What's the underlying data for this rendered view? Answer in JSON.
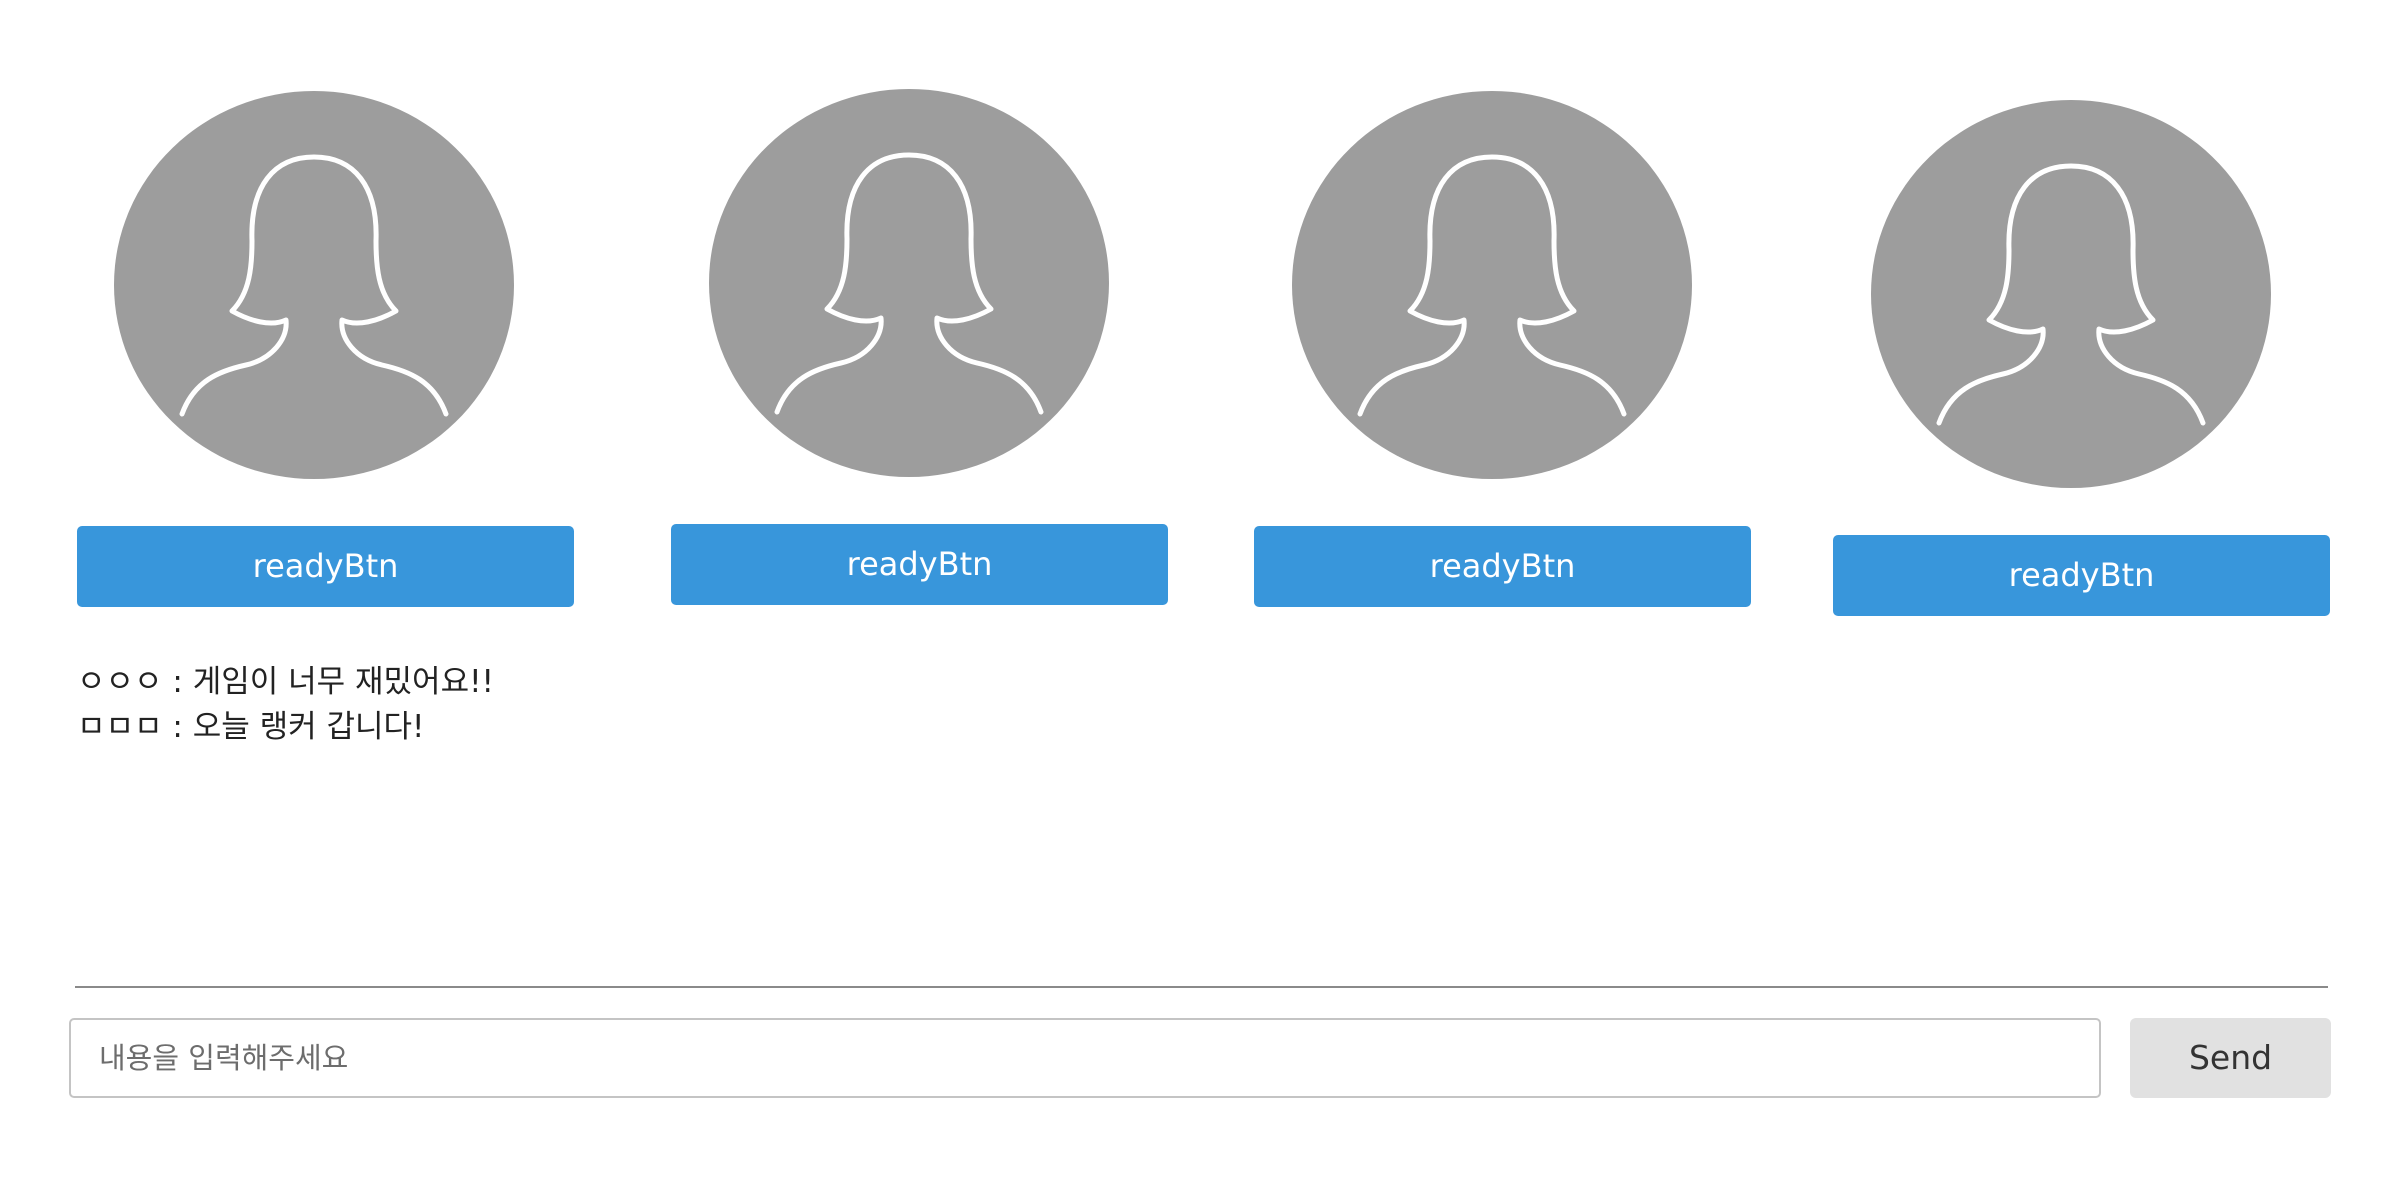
{
  "players": [
    {
      "ready_label": "readyBtn",
      "avatar_icon": "female-user-silhouette-icon"
    },
    {
      "ready_label": "readyBtn",
      "avatar_icon": "female-user-silhouette-icon"
    },
    {
      "ready_label": "readyBtn",
      "avatar_icon": "female-user-silhouette-icon"
    },
    {
      "ready_label": "readyBtn",
      "avatar_icon": "female-user-silhouette-icon"
    }
  ],
  "chat": {
    "messages": [
      {
        "text": "ㅇㅇㅇ : 게임이 너무 재밌어요!!"
      },
      {
        "text": "ㅁㅁㅁ : 오늘 랭커 갑니다!"
      }
    ]
  },
  "composer": {
    "placeholder": "내용을 입력해주세요",
    "value": "",
    "send_label": "Send"
  },
  "colors": {
    "accent": "#3896db",
    "avatar_bg": "#9d9d9d",
    "send_bg": "#e1e1e1"
  }
}
